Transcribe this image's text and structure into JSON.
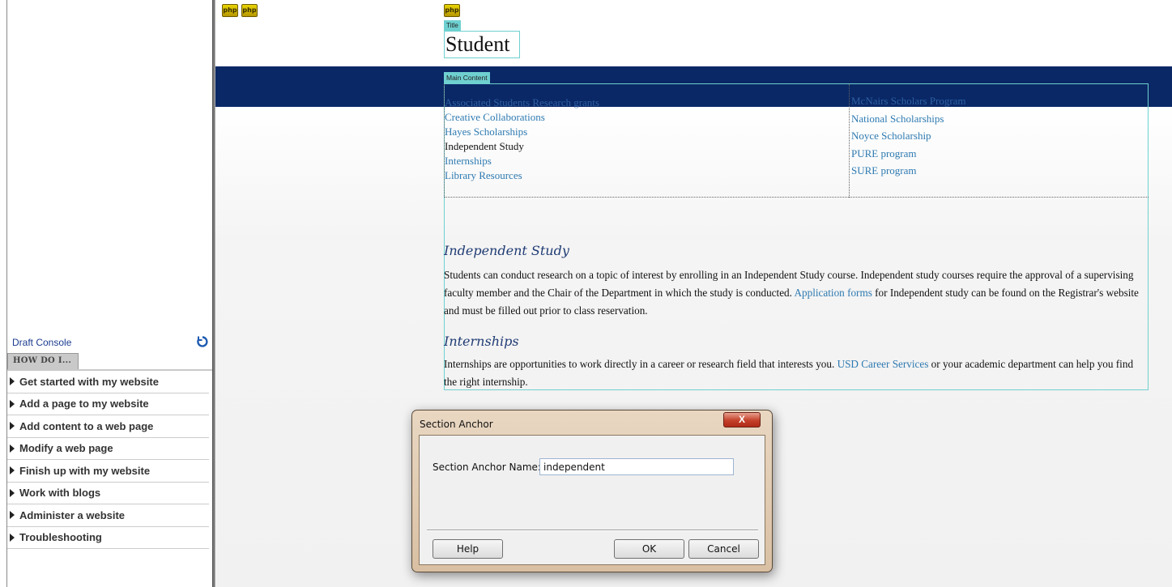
{
  "left_panel": {
    "draft_console": "Draft Console",
    "how_do_i_tab": "HOW DO I...",
    "items": [
      {
        "label": "Get started with my website"
      },
      {
        "label": "Add a page to my website"
      },
      {
        "label": "Add content to a web page"
      },
      {
        "label": "Modify a web page"
      },
      {
        "label": "Finish up with my website"
      },
      {
        "label": "Work with blogs"
      },
      {
        "label": "Administer a website"
      },
      {
        "label": "Troubleshooting"
      }
    ]
  },
  "page": {
    "php_badge": "php",
    "title_label": "Title",
    "title": "Student",
    "main_content_label": "Main Content",
    "left_links": [
      "Associated Students Research grants",
      "Creative Collaborations",
      "Hayes Scholarships",
      "Independent Study",
      "Internships",
      "Library Resources"
    ],
    "right_links": [
      "McNairs Scholars Program",
      "National Scholarships",
      "Noyce Scholarship",
      "PURE program",
      "SURE program"
    ],
    "sections": [
      {
        "heading": "Independent Study",
        "text_before": "Students can conduct research on a topic of interest by enrolling in an Independent Study course. Independent study courses require the approval of a supervising faculty member and the Chair of the Department in which the study is conducted. ",
        "link": "Application forms",
        "text_after": " for Independent study can be found on the Registrar's website and must be filled out prior to class reservation."
      },
      {
        "heading": "Internships",
        "text_before": "Internships are opportunities to work directly in a career or research field that interests you. ",
        "link": "USD Career Services",
        "text_after": " or your academic department can help you find the right internship."
      }
    ]
  },
  "dialog": {
    "title": "Section Anchor",
    "close_glyph": "X",
    "field_label": "Section Anchor Name:",
    "field_value": "independent",
    "help_label": "Help",
    "ok_label": "OK",
    "cancel_label": "Cancel"
  },
  "colors": {
    "navy_band": "#0a2866",
    "link": "#2e7ab1",
    "editor_label": "#6fd0d0"
  }
}
